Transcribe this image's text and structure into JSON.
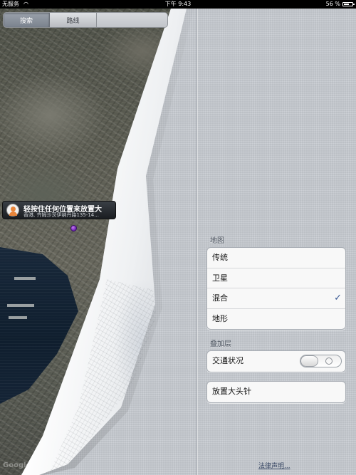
{
  "status_bar": {
    "carrier": "无服务",
    "time": "下午 9:43",
    "battery_percent": "56 %",
    "battery_level": 0.56
  },
  "map": {
    "segments": [
      "搜索",
      "路线"
    ],
    "callout": {
      "title": "轻按住任何位置来放置大",
      "subtitle": "香港, 齐姆沙茨伊纳丹路135-14..."
    },
    "logo": "Google"
  },
  "settings": {
    "map_section_label": "地图",
    "map_types": [
      {
        "label": "传统",
        "selected": false
      },
      {
        "label": "卫星",
        "selected": false
      },
      {
        "label": "混合",
        "selected": true
      },
      {
        "label": "地形",
        "selected": false
      }
    ],
    "overlay_section_label": "叠加层",
    "traffic_label": "交通状况",
    "traffic_on": false,
    "drop_pin_label": "放置大头针",
    "legal_link": "法律声明..."
  },
  "colors": {
    "linen": "#c8ccd2",
    "checkmark": "#3a5a94",
    "pin": "#7b2fc4"
  }
}
